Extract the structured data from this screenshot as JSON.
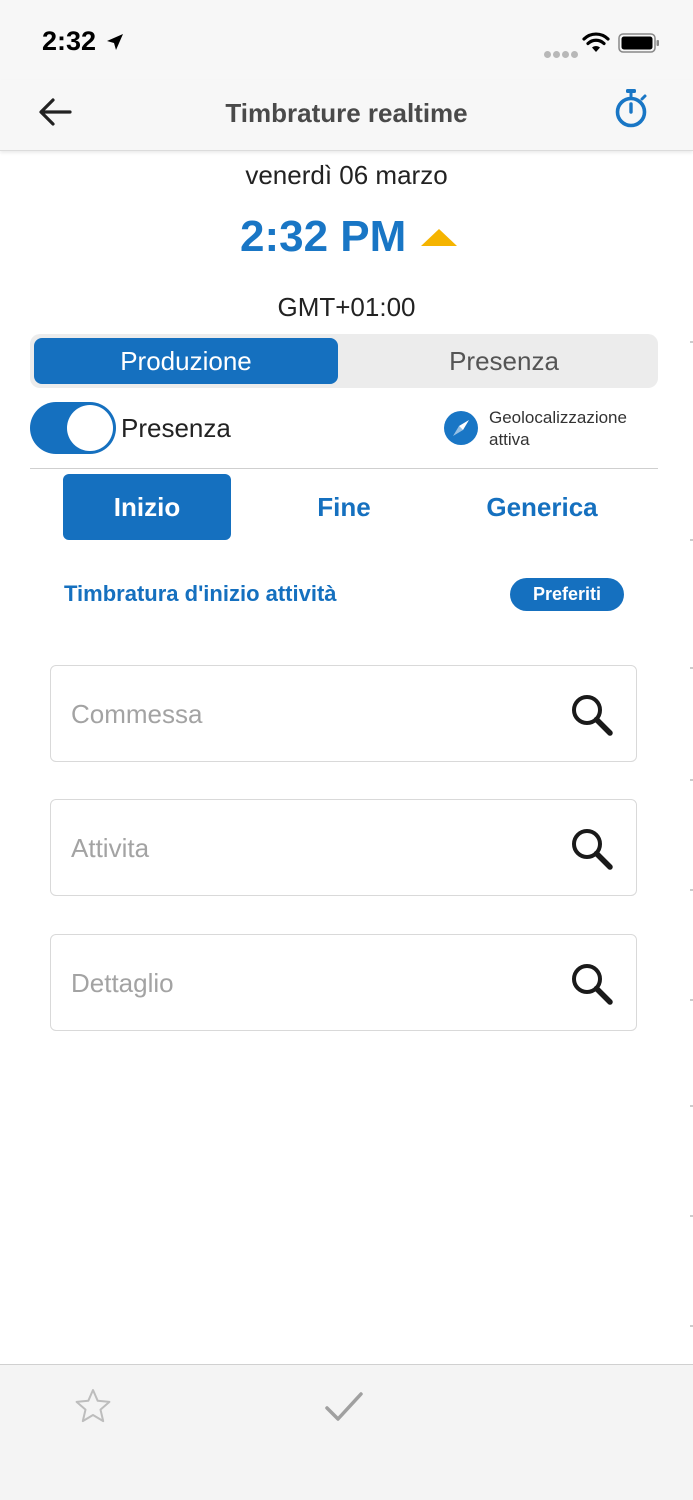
{
  "status_bar": {
    "time": "2:32",
    "icons": [
      "location-arrow-icon",
      "signal-dots-icon",
      "wifi-icon",
      "battery-icon"
    ]
  },
  "nav": {
    "title": "Timbrature realtime",
    "back_icon": "back-arrow-icon",
    "timer_icon": "stopwatch-icon"
  },
  "header": {
    "date": "venerdì 06 marzo",
    "time": "2:32 PM",
    "timezone": "GMT+01:00"
  },
  "segment": {
    "options": [
      "Produzione",
      "Presenza"
    ],
    "selected": "Produzione"
  },
  "presence_toggle": {
    "label": "Presenza",
    "on": true
  },
  "geolocation": {
    "line1": "Geolocalizzazione",
    "line2": "attiva",
    "icon": "compass-icon"
  },
  "tabs": {
    "items": [
      "Inizio",
      "Fine",
      "Generica"
    ],
    "selected": "Inizio"
  },
  "section": {
    "subtitle": "Timbratura d'inizio attività",
    "favorites_label": "Preferiti"
  },
  "fields": [
    {
      "placeholder": "Commessa",
      "value": ""
    },
    {
      "placeholder": "Attivita",
      "value": ""
    },
    {
      "placeholder": "Dettaglio",
      "value": ""
    }
  ],
  "bottom_bar": {
    "icons": [
      "star-icon",
      "checkmark-icon"
    ]
  },
  "colors": {
    "accent": "#1570bf",
    "clock": "#1976c5",
    "arrow": "#f5b400"
  }
}
